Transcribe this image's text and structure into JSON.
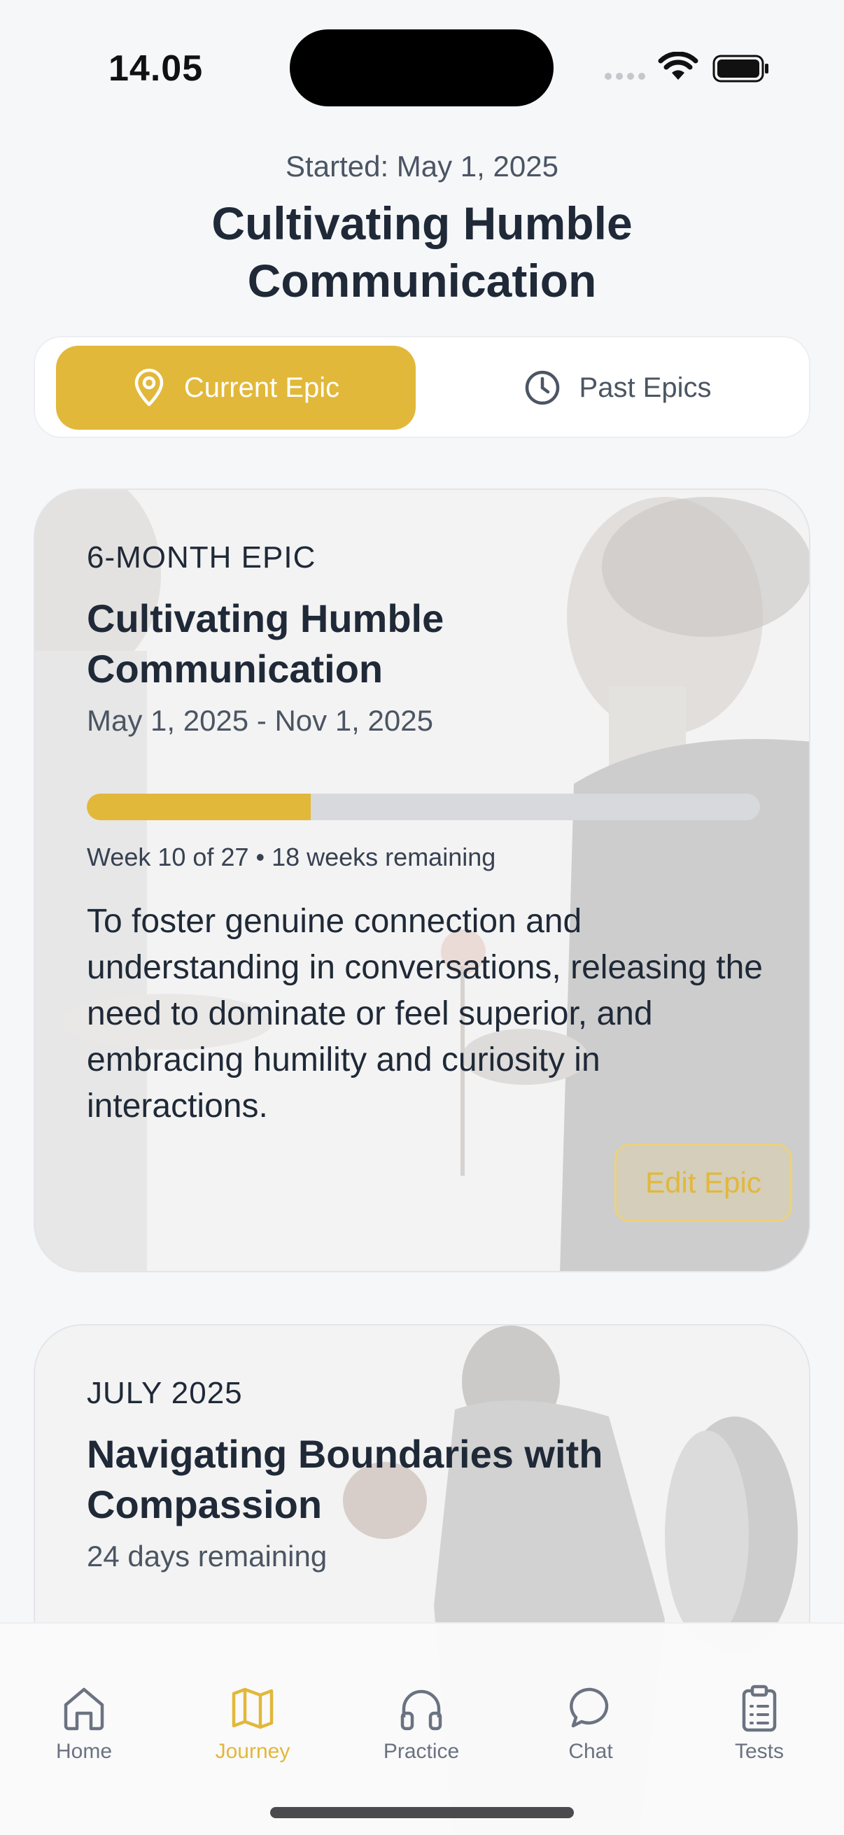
{
  "status_bar": {
    "time": "14.05"
  },
  "header": {
    "started": "Started: May 1, 2025",
    "title": "Cultivating Humble Communication"
  },
  "segments": {
    "current": {
      "label": "Current Epic",
      "icon": "map-pin-icon"
    },
    "past": {
      "label": "Past Epics",
      "icon": "clock-icon"
    }
  },
  "current_epic": {
    "eyebrow": "6-MONTH EPIC",
    "title": "Cultivating Humble Communication",
    "dates": "May 1, 2025 - Nov 1, 2025",
    "progress_fraction": 0.333,
    "progress_text": "Week 10 of 27 • 18 weeks remaining",
    "goal": "To foster genuine connection and understanding in conversations, releasing the need to dominate or feel superior, and embracing humility and curiosity in interactions.",
    "edit_label": "Edit Epic"
  },
  "monthly_epic": {
    "eyebrow": "JULY 2025",
    "title": "Navigating Boundaries with Compassion",
    "remaining": "24 days remaining"
  },
  "tabs": [
    {
      "label": "Home",
      "icon": "home-icon",
      "active": false
    },
    {
      "label": "Journey",
      "icon": "map-icon",
      "active": true
    },
    {
      "label": "Practice",
      "icon": "headphones-icon",
      "active": false
    },
    {
      "label": "Chat",
      "icon": "chat-bubble-icon",
      "active": false
    },
    {
      "label": "Tests",
      "icon": "clipboard-icon",
      "active": false
    }
  ],
  "colors": {
    "accent": "#e2b83a",
    "text": "#1f2937",
    "muted": "#6b7280",
    "background": "#f6f7f9"
  }
}
